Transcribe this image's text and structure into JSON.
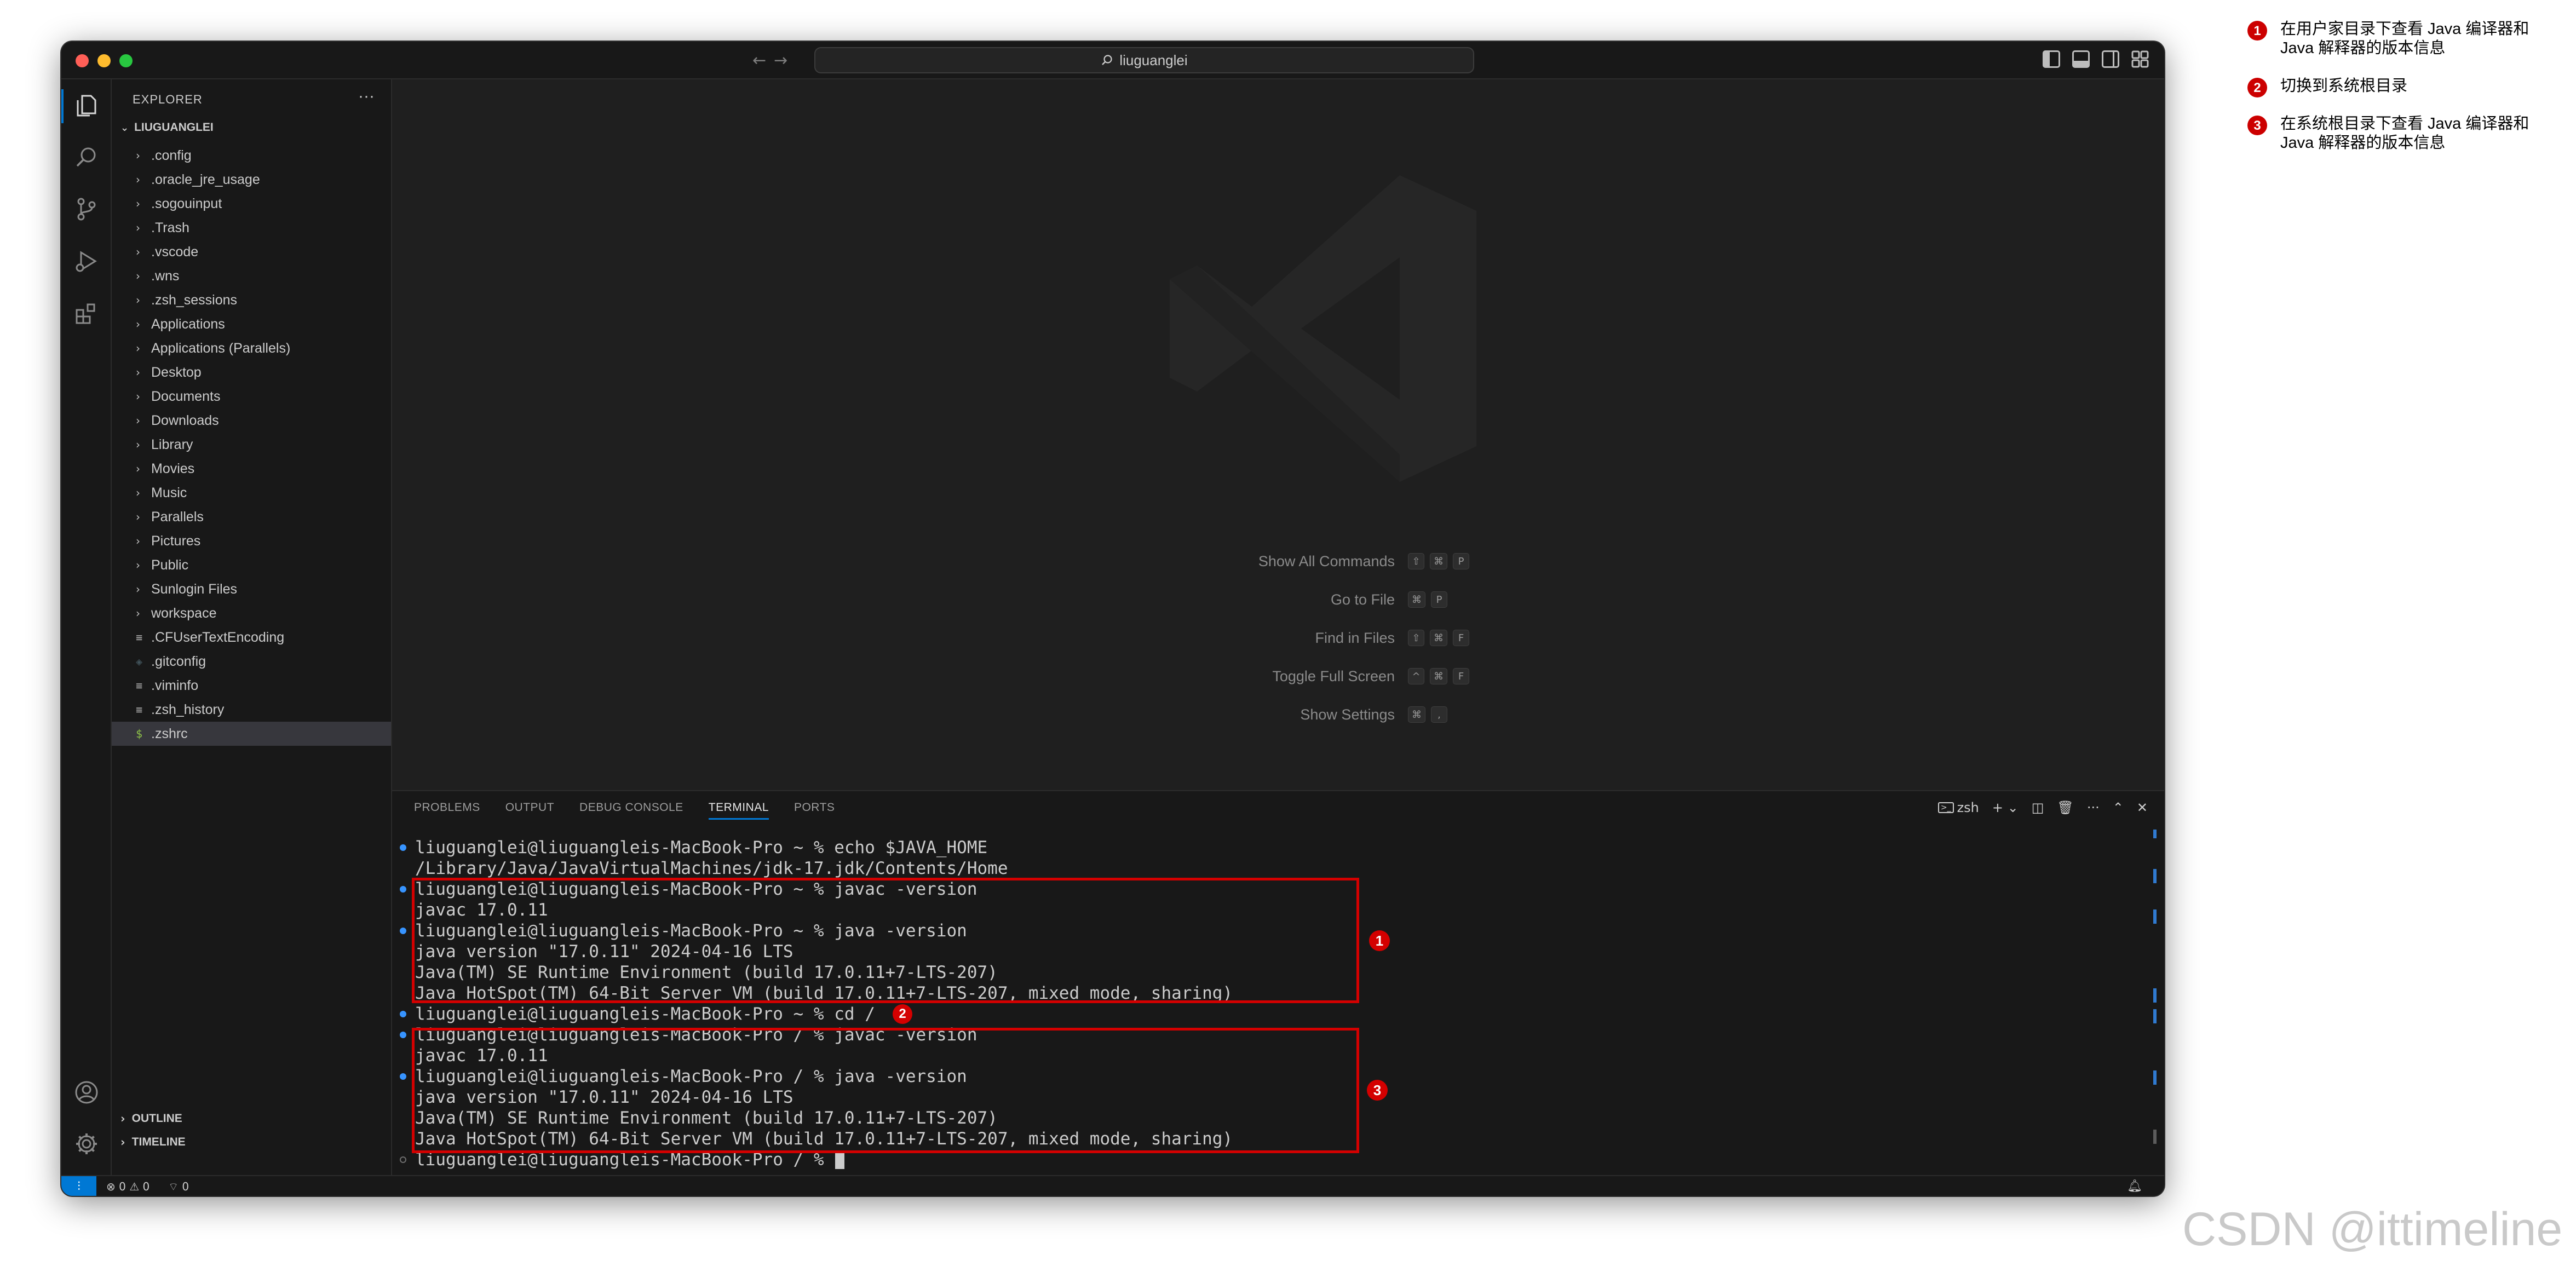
{
  "titlebar": {
    "search_text": "liuguanglei",
    "traffic_lights": {
      "close": "#ff5f57",
      "minimize": "#febc2e",
      "maximize": "#28c840"
    }
  },
  "activity_bar": {
    "top_icons": [
      "explorer-icon",
      "search-icon",
      "source-control-icon",
      "run-debug-icon",
      "extensions-icon"
    ],
    "bottom_icons": [
      "account-icon",
      "settings-gear-icon"
    ]
  },
  "sidebar": {
    "title": "EXPLORER",
    "more": "···",
    "root": "LIUGUANGLEI",
    "items": [
      {
        "label": ".config",
        "type": "folder"
      },
      {
        "label": ".oracle_jre_usage",
        "type": "folder"
      },
      {
        "label": ".sogouinput",
        "type": "folder"
      },
      {
        "label": ".Trash",
        "type": "folder"
      },
      {
        "label": ".vscode",
        "type": "folder"
      },
      {
        "label": ".wns",
        "type": "folder"
      },
      {
        "label": ".zsh_sessions",
        "type": "folder"
      },
      {
        "label": "Applications",
        "type": "folder"
      },
      {
        "label": "Applications (Parallels)",
        "type": "folder"
      },
      {
        "label": "Desktop",
        "type": "folder"
      },
      {
        "label": "Documents",
        "type": "folder"
      },
      {
        "label": "Downloads",
        "type": "folder"
      },
      {
        "label": "Library",
        "type": "folder"
      },
      {
        "label": "Movies",
        "type": "folder"
      },
      {
        "label": "Music",
        "type": "folder"
      },
      {
        "label": "Parallels",
        "type": "folder"
      },
      {
        "label": "Pictures",
        "type": "folder"
      },
      {
        "label": "Public",
        "type": "folder"
      },
      {
        "label": "Sunlogin Files",
        "type": "folder"
      },
      {
        "label": "workspace",
        "type": "folder"
      },
      {
        "label": ".CFUserTextEncoding",
        "type": "file"
      },
      {
        "label": ".gitconfig",
        "type": "git"
      },
      {
        "label": ".viminfo",
        "type": "file"
      },
      {
        "label": ".zsh_history",
        "type": "file"
      },
      {
        "label": ".zshrc",
        "type": "shell",
        "selected": true
      }
    ],
    "sections": {
      "outline": "OUTLINE",
      "timeline": "TIMELINE"
    }
  },
  "editor": {
    "hints": [
      {
        "label": "Show All Commands",
        "keys": [
          "⇧",
          "⌘",
          "P"
        ]
      },
      {
        "label": "Go to File",
        "keys": [
          "⌘",
          "P"
        ]
      },
      {
        "label": "Find in Files",
        "keys": [
          "⇧",
          "⌘",
          "F"
        ]
      },
      {
        "label": "Toggle Full Screen",
        "keys": [
          "^",
          "⌘",
          "F"
        ]
      },
      {
        "label": "Show Settings",
        "keys": [
          "⌘",
          ","
        ]
      }
    ]
  },
  "panel": {
    "tabs": [
      "PROBLEMS",
      "OUTPUT",
      "DEBUG CONSOLE",
      "TERMINAL",
      "PORTS"
    ],
    "active_tab": "TERMINAL",
    "shell": "zsh",
    "terminal_lines": [
      {
        "text": "liuguanglei@liuguangleis-MacBook-Pro ~ % echo $JAVA_HOME",
        "dot": "blue"
      },
      {
        "text": "/Library/Java/JavaVirtualMachines/jdk-17.jdk/Contents/Home",
        "dot": ""
      },
      {
        "text": "liuguanglei@liuguangleis-MacBook-Pro ~ % javac -version",
        "dot": "blue"
      },
      {
        "text": "javac 17.0.11",
        "dot": ""
      },
      {
        "text": "liuguanglei@liuguangleis-MacBook-Pro ~ % java -version",
        "dot": "blue"
      },
      {
        "text": "java version \"17.0.11\" 2024-04-16 LTS",
        "dot": ""
      },
      {
        "text": "Java(TM) SE Runtime Environment (build 17.0.11+7-LTS-207)",
        "dot": ""
      },
      {
        "text": "Java HotSpot(TM) 64-Bit Server VM (build 17.0.11+7-LTS-207, mixed mode, sharing)",
        "dot": ""
      },
      {
        "text": "liuguanglei@liuguangleis-MacBook-Pro ~ % cd /",
        "dot": "blue"
      },
      {
        "text": "liuguanglei@liuguangleis-MacBook-Pro / % javac -version",
        "dot": "blue"
      },
      {
        "text": "javac 17.0.11",
        "dot": ""
      },
      {
        "text": "liuguanglei@liuguangleis-MacBook-Pro / % java -version",
        "dot": "blue"
      },
      {
        "text": "java version \"17.0.11\" 2024-04-16 LTS",
        "dot": ""
      },
      {
        "text": "Java(TM) SE Runtime Environment (build 17.0.11+7-LTS-207)",
        "dot": ""
      },
      {
        "text": "Java HotSpot(TM) 64-Bit Server VM (build 17.0.11+7-LTS-207, mixed mode, sharing)",
        "dot": ""
      },
      {
        "text": "liuguanglei@liuguangleis-MacBook-Pro / % ",
        "dot": "hollow",
        "cursor": true
      }
    ]
  },
  "statusbar": {
    "errors": "0",
    "warnings": "0",
    "ports": "0"
  },
  "annotations": {
    "badges": [
      "1",
      "2",
      "3"
    ],
    "color": "#d40000"
  },
  "legend": [
    {
      "num": "1",
      "text": "在用户家目录下查看 Java 编译器和 Java 解释器的版本信息"
    },
    {
      "num": "2",
      "text": "切换到系统根目录"
    },
    {
      "num": "3",
      "text": "在系统根目录下查看 Java 编译器和 Java 解释器的版本信息"
    }
  ],
  "watermark": "CSDN @ittimeline"
}
